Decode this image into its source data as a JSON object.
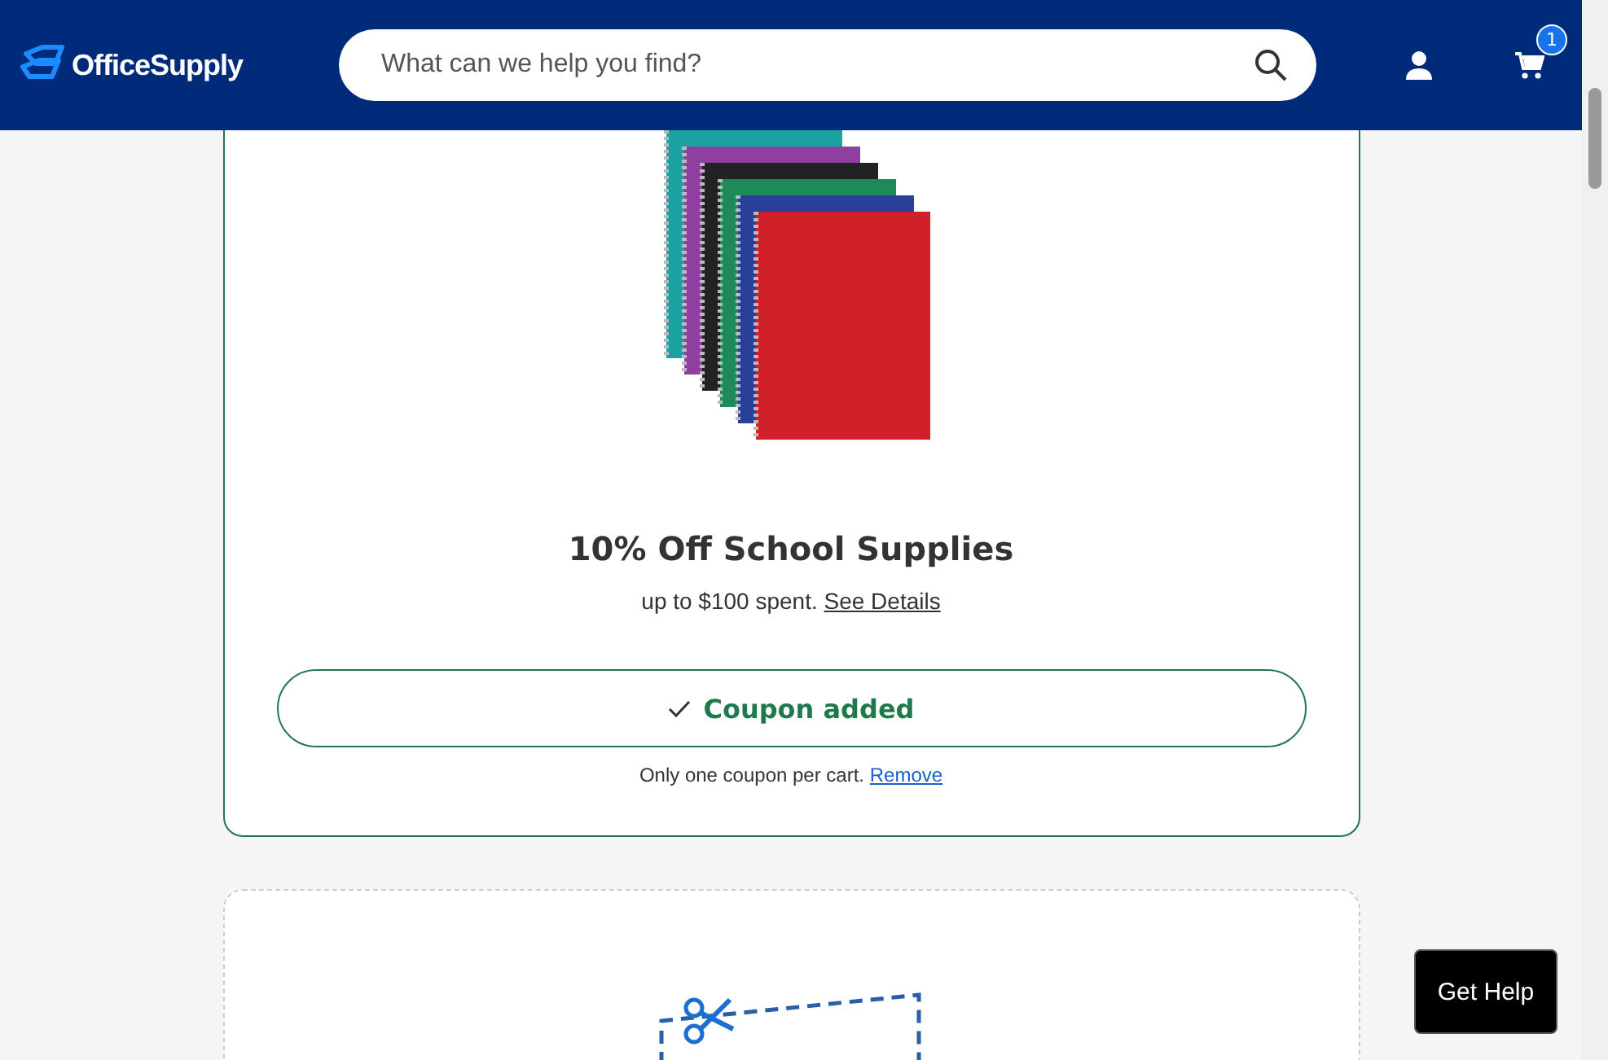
{
  "header": {
    "logo": "OfficeSupply",
    "search": {
      "placeholder": "What can we help you find?"
    },
    "cart_count": "1"
  },
  "coupons": [
    {
      "kind": "clipped",
      "title": "10% Off School Supplies",
      "terms": "up to $100 spent.",
      "details_link": "See Details",
      "button": "Coupon added",
      "added": true,
      "note": "Only one coupon per cart.",
      "note_link": "Remove"
    },
    {
      "kind": "empty"
    }
  ],
  "help_button": "Get Help"
}
